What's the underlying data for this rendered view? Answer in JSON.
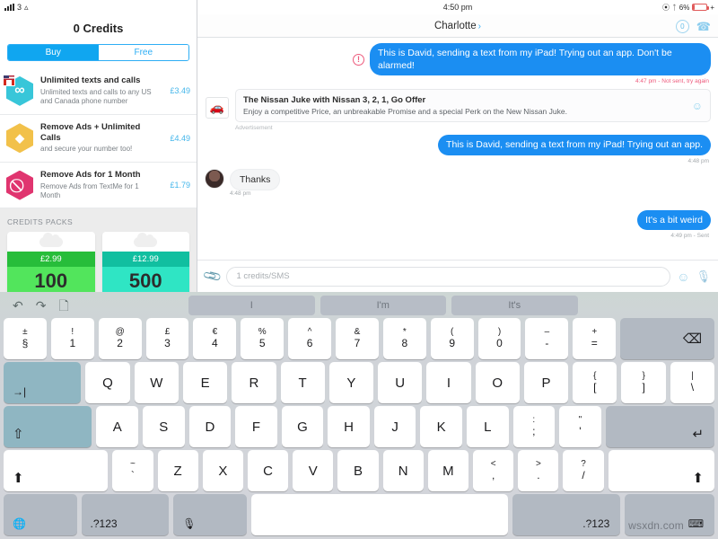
{
  "status_bar": {
    "carrier_signal": "signal-bars",
    "carrier_label": "3",
    "wifi": "wifi-icon",
    "time": "4:50 pm",
    "location_icon": "location-icon",
    "bluetooth_icon": "bluetooth-icon",
    "battery_percent": "6%",
    "battery_charging": "+"
  },
  "store_panel": {
    "title": "0 Credits",
    "segments": [
      {
        "label": "Buy",
        "active": true
      },
      {
        "label": "Free",
        "active": false
      }
    ],
    "products": [
      {
        "icon": "infinity-hex-icon",
        "badge": "us-ca-flags",
        "title": "Unlimited texts and calls",
        "subtitle": "Unlimited texts and calls to any US and Canada phone number",
        "price": "£3.49"
      },
      {
        "icon": "diamond-hex-icon",
        "title": "Remove Ads + Unlimited Calls",
        "subtitle": "and secure your number too!",
        "price": "£4.49"
      },
      {
        "icon": "no-ads-hex-icon",
        "title": "Remove Ads for 1 Month",
        "subtitle": "Remove Ads from TextMe for 1 Month",
        "price": "£1.79"
      }
    ],
    "packs_header": "CREDITS PACKS",
    "packs": [
      {
        "price": "£2.99",
        "amount": "100"
      },
      {
        "price": "£12.99",
        "amount": "500"
      }
    ]
  },
  "chat": {
    "contact_name": "Charlotte",
    "contact_chevron": "›",
    "credits_badge": "0",
    "call_icon": "phone-icon",
    "messages": [
      {
        "kind": "outgoing",
        "text": "This is David, sending a text from my iPad! Trying out an app. Don't be alarmed!",
        "meta": "4:47 pm - Not sent, try again",
        "failed": true,
        "warning_icon": "alert-icon"
      },
      {
        "kind": "ad",
        "title": "The Nissan Juke with Nissan 3, 2, 1, Go Offer",
        "body": "Enjoy a competitive Price, an unbreakable Promise and a special Perk on the New Nissan Juke.",
        "thumb_icon": "car-icon",
        "action_icon": "smiley-icon",
        "label": "Advertisement"
      },
      {
        "kind": "outgoing",
        "text": "This is David, sending a text from my iPad! Trying out an app.",
        "meta": "4:48 pm",
        "failed": false
      },
      {
        "kind": "incoming",
        "text": "Thanks",
        "meta": "4:48 pm",
        "avatar": "contact-avatar"
      },
      {
        "kind": "outgoing",
        "text": "It's a bit weird",
        "meta": "4:49 pm - Sent",
        "failed": false
      }
    ],
    "composer": {
      "attach_icon": "paperclip-icon",
      "placeholder": "1 credits/SMS",
      "value": "",
      "emoji_icon": "smiley-icon",
      "mic_icon": "microphone-icon"
    }
  },
  "keyboard": {
    "tools": [
      "undo-icon",
      "redo-icon",
      "copy-icon"
    ],
    "predictions": [
      "I",
      "I'm",
      "It's"
    ],
    "row_numbers": [
      {
        "up": "±",
        "lo": "§"
      },
      {
        "up": "!",
        "lo": "1"
      },
      {
        "up": "@",
        "lo": "2"
      },
      {
        "up": "£",
        "lo": "3"
      },
      {
        "up": "€",
        "lo": "4"
      },
      {
        "up": "%",
        "lo": "5"
      },
      {
        "up": "^",
        "lo": "6"
      },
      {
        "up": "&",
        "lo": "7"
      },
      {
        "up": "*",
        "lo": "8"
      },
      {
        "up": "(",
        "lo": "9"
      },
      {
        "up": ")",
        "lo": "0"
      },
      {
        "up": "–",
        "lo": "-"
      },
      {
        "up": "+",
        "lo": "="
      }
    ],
    "backspace": "⌫",
    "tab": "→|",
    "row_top": [
      "Q",
      "W",
      "E",
      "R",
      "T",
      "Y",
      "U",
      "I",
      "O",
      "P"
    ],
    "row_top_extra": [
      {
        "up": "{",
        "lo": "["
      },
      {
        "up": "}",
        "lo": "]"
      },
      {
        "up": "|",
        "lo": "\\"
      }
    ],
    "capslock": "⇧",
    "row_home": [
      "A",
      "S",
      "D",
      "F",
      "G",
      "H",
      "J",
      "K",
      "L"
    ],
    "row_home_extra": [
      {
        "up": ":",
        "lo": ";"
      },
      {
        "up": "\"",
        "lo": "'"
      }
    ],
    "return": "↵",
    "shift_left": "⬆",
    "tilde": {
      "up": "~",
      "lo": "`"
    },
    "row_bottom": [
      "Z",
      "X",
      "C",
      "V",
      "B",
      "N",
      "M"
    ],
    "row_bottom_extra": [
      {
        "up": "<",
        "lo": ","
      },
      {
        "up": ">",
        "lo": "."
      },
      {
        "up": "?",
        "lo": "/"
      }
    ],
    "shift_right": "⬆",
    "globe": "🌐",
    "num_left": ".?123",
    "dictation": "🎙",
    "space": "",
    "num_right": ".?123",
    "hide_keyboard": "⌨"
  },
  "watermark": "wsxdn.com"
}
